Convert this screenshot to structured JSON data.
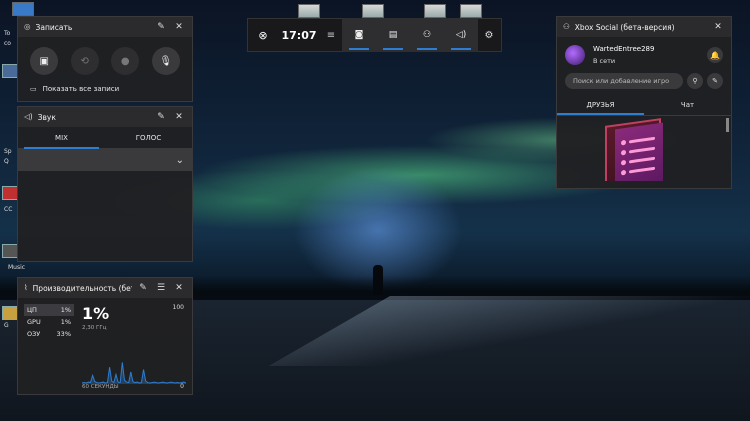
{
  "desktop": {
    "left_labels": [
      "To",
      "co",
      "Sp",
      "Q",
      "CC",
      "Music",
      "G"
    ]
  },
  "capture": {
    "title": "Записать",
    "show_all_label": "Показать все записи"
  },
  "audio": {
    "title": "Звук",
    "tabs": [
      {
        "label": "MIX",
        "active": true
      },
      {
        "label": "ГОЛОС",
        "active": false
      }
    ]
  },
  "performance": {
    "title": "Производительность (бета-ве",
    "metrics": [
      {
        "label": "ЦП",
        "value": "1%",
        "active": true
      },
      {
        "label": "GPU",
        "value": "1%",
        "active": false
      },
      {
        "label": "ОЗУ",
        "value": "33%",
        "active": false
      }
    ],
    "current_value": "1%",
    "frequency": "2,30 ГГц",
    "max_label": "100",
    "min_label": "0",
    "duration_label": "60 СЕКУНДЫ",
    "chart_data": {
      "type": "area",
      "x_label": "60 СЕКУНДЫ",
      "ylim": [
        0,
        100
      ],
      "values": [
        2,
        3,
        2,
        4,
        3,
        18,
        5,
        3,
        2,
        3,
        4,
        2,
        3,
        35,
        6,
        3,
        20,
        4,
        3,
        45,
        8,
        4,
        3,
        25,
        5,
        3,
        4,
        2,
        3,
        30,
        6,
        3,
        2,
        3,
        4,
        3,
        2,
        3,
        4,
        3,
        2,
        3,
        4,
        3,
        2,
        3,
        2,
        3,
        4,
        2
      ]
    },
    "accent_color": "#2d7dd2"
  },
  "toolbar": {
    "time": "17:07",
    "widgets": [
      "capture-widget",
      "audio-widget",
      "performance-widget",
      "volume-widget"
    ]
  },
  "social": {
    "title": "Xbox Social (бета-версия)",
    "gamertag": "WartedEntree289",
    "status": "В сети",
    "search_placeholder": "Поиск или добавление игро",
    "tabs": [
      {
        "label": "ДРУЗЬЯ",
        "active": true
      },
      {
        "label": "Чат",
        "active": false
      }
    ]
  }
}
